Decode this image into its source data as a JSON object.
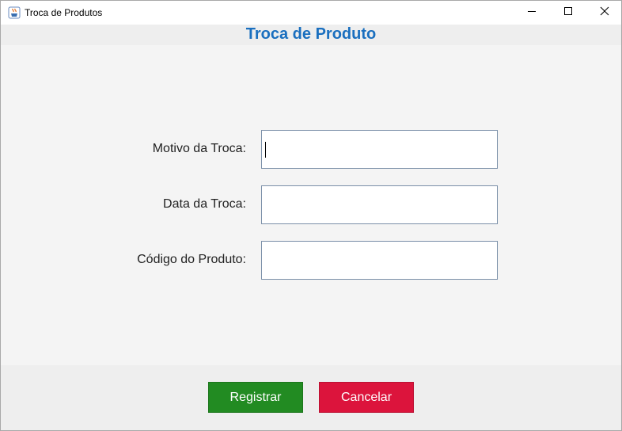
{
  "window": {
    "title": "Troca de Produtos",
    "controls": {
      "minimize": "minimize",
      "maximize": "maximize",
      "close": "close"
    }
  },
  "header": {
    "title": "Troca de Produto",
    "title_color": "#1a6fbf"
  },
  "form": {
    "fields": [
      {
        "label": "Motivo da Troca:",
        "value": "",
        "focused": true
      },
      {
        "label": "Data da Troca:",
        "value": "",
        "focused": false
      },
      {
        "label": "Código do Produto:",
        "value": "",
        "focused": false
      }
    ]
  },
  "footer": {
    "register_label": "Registrar",
    "register_color": "#228b22",
    "cancel_label": "Cancelar",
    "cancel_color": "#dc143c"
  },
  "icons": {
    "app": "java-cup-icon",
    "minimize": "minimize-icon",
    "maximize": "maximize-icon",
    "close": "close-icon"
  }
}
